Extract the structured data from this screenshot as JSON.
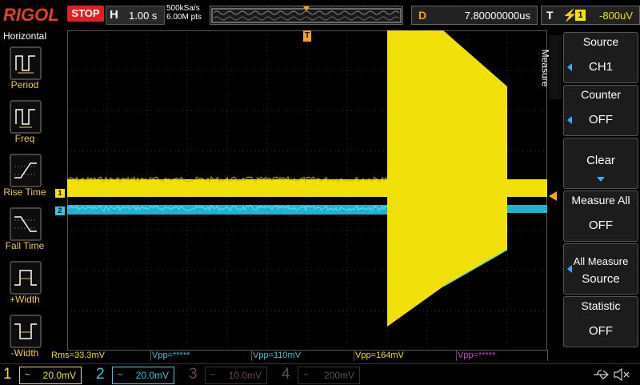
{
  "header": {
    "brand": "RIGOL",
    "run_state": "STOP",
    "horizontal_key": "H",
    "timebase": "1.00 s",
    "sample_rate": "500kSa/s",
    "memory_depth": "6.00M pts",
    "delay_key": "D",
    "delay_value": "7.80000000us",
    "trigger_key": "T",
    "trigger_channel": "1",
    "trigger_level": "-800uV"
  },
  "left_panel": {
    "title": "Horizontal",
    "items": [
      {
        "label": "Period",
        "icon": "period-icon"
      },
      {
        "label": "Freq",
        "icon": "freq-icon"
      },
      {
        "label": "Rise Time",
        "icon": "rise-time-icon"
      },
      {
        "label": "Fall Time",
        "icon": "fall-time-icon"
      },
      {
        "label": "+Width",
        "icon": "pos-width-icon"
      },
      {
        "label": "-Width",
        "icon": "neg-width-icon"
      }
    ]
  },
  "right_panel": {
    "tab_label": "Measure",
    "source_title": "Source",
    "source_value": "CH1",
    "counter_title": "Counter",
    "counter_value": "OFF",
    "clear_label": "Clear",
    "measure_all_title": "Measure All",
    "measure_all_value": "OFF",
    "all_measure_source_title": "All Measure",
    "all_measure_source_value": "Source",
    "statistic_title": "Statistic",
    "statistic_value": "OFF"
  },
  "markers": {
    "ch1": "1",
    "ch2": "2",
    "trigger_pos": "T"
  },
  "measurements": [
    {
      "text": "Rms=33.3mV",
      "color": "#f1e00a"
    },
    {
      "text": "Vpp=*****",
      "color": "#2ec8e0"
    },
    {
      "text": "Vpp=110mV",
      "color": "#2ec8e0"
    },
    {
      "text": "Vpp=164mV",
      "color": "#f1e00a"
    },
    {
      "text": "Vpp=*****",
      "color": "#d040d0"
    }
  ],
  "channels": [
    {
      "num": "1",
      "coupling": "~",
      "scale": "20.0mV",
      "color": "#f1e00a",
      "active": true
    },
    {
      "num": "2",
      "coupling": "~",
      "scale": "20.0mV",
      "color": "#2ec8e0",
      "active": true
    },
    {
      "num": "3",
      "coupling": "~",
      "scale": "10.0mV",
      "color": "#6a4060",
      "active": false
    },
    {
      "num": "4",
      "coupling": "~",
      "scale": "200mV",
      "color": "#555555",
      "active": false
    }
  ],
  "status_icons": [
    "usb-icon",
    "speaker-mute-icon"
  ],
  "colors": {
    "ch1": "#f1e00a",
    "ch2": "#2ec8e0",
    "ch4_math": "#d040d0",
    "trigger": "#f7a21b",
    "stop": "#e02020",
    "brand": "#e8401c"
  }
}
